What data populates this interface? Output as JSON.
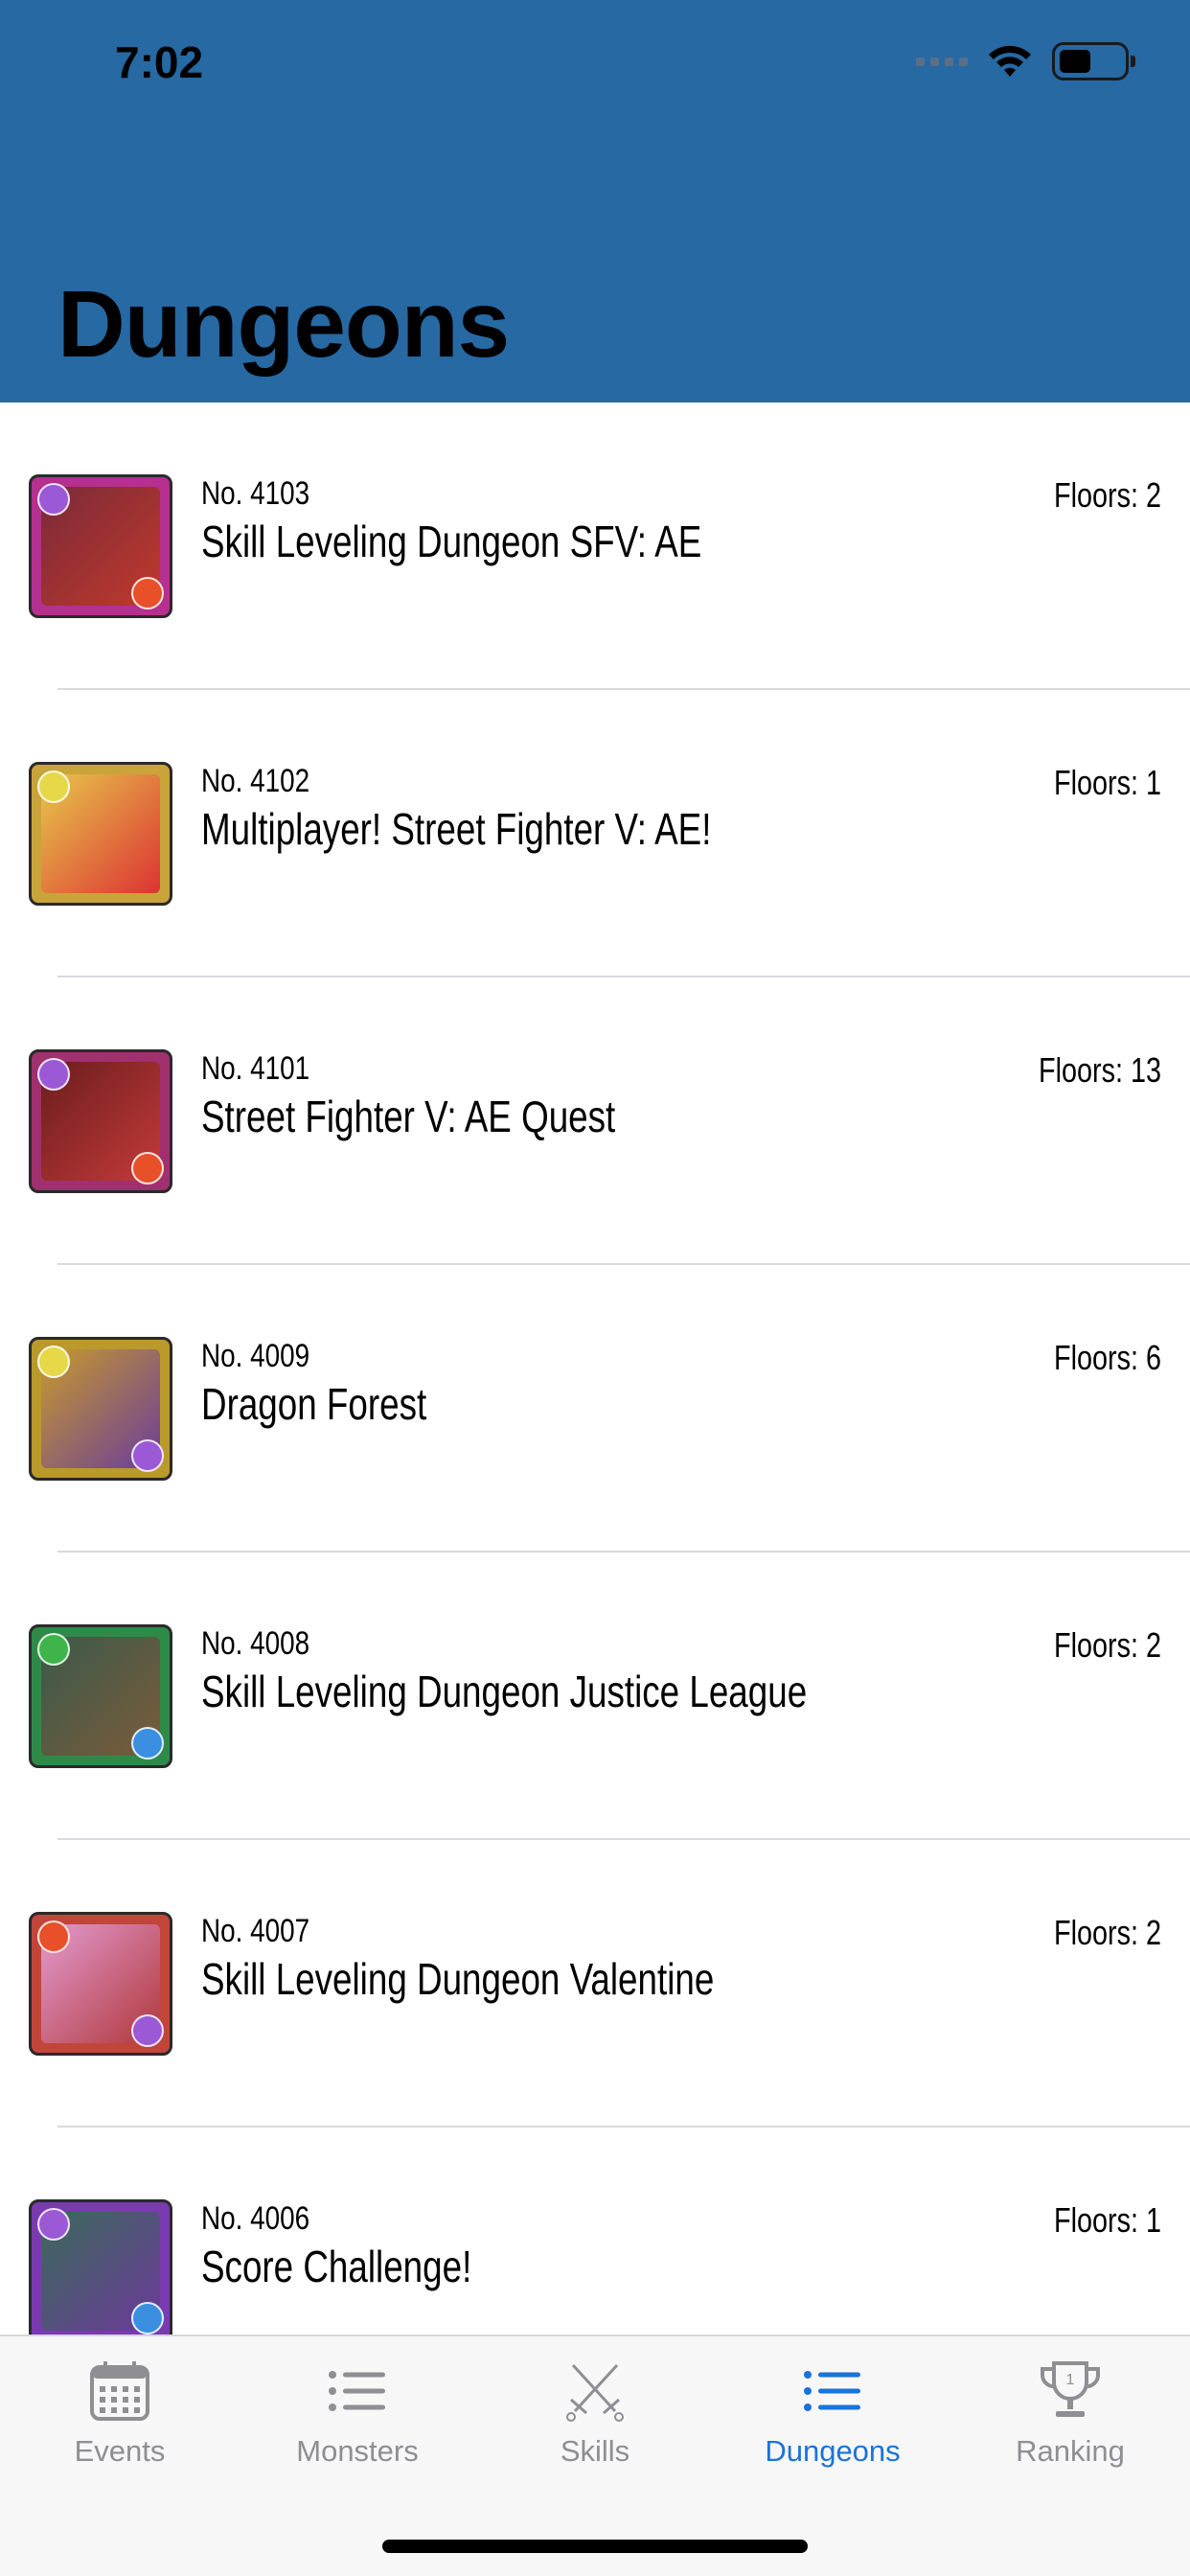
{
  "status": {
    "time": "7:02"
  },
  "header": {
    "title": "Dungeons"
  },
  "colors": {
    "header_bg": "#2669a3",
    "tab_active": "#1a73d9",
    "tab_inactive": "#8e8e93"
  },
  "dungeons": [
    {
      "number": "No. 4103",
      "name": "Skill Leveling Dungeon SFV: AE",
      "floors": "Floors: 2",
      "portrait": [
        "#7a2a3a",
        "#c0392b"
      ],
      "frame": "#b5308f",
      "orb_tl": "#9b59d6",
      "orb_br": "#e8502a"
    },
    {
      "number": "No. 4102",
      "name": "Multiplayer! Street Fighter V: AE!",
      "floors": "Floors: 1",
      "portrait": [
        "#e7c74a",
        "#d33"
      ],
      "frame": "#c9a43b",
      "orb_tl": "#e7d84a",
      "orb_br": null
    },
    {
      "number": "No. 4101",
      "name": "Street Fighter V: AE Quest",
      "floors": "Floors: 13",
      "portrait": [
        "#6b1d1d",
        "#c43a3a"
      ],
      "frame": "#a0306e",
      "orb_tl": "#9b59d6",
      "orb_br": "#e8502a"
    },
    {
      "number": "No. 4009",
      "name": "Dragon Forest",
      "floors": "Floors: 6",
      "portrait": [
        "#c89a2d",
        "#6a3d9a"
      ],
      "frame": "#b99a2b",
      "orb_tl": "#e7d84a",
      "orb_br": "#9b59d6"
    },
    {
      "number": "No. 4008",
      "name": "Skill Leveling Dungeon Justice League",
      "floors": "Floors: 2",
      "portrait": [
        "#3a5a4a",
        "#7b5b3a"
      ],
      "frame": "#2f8a4a",
      "orb_tl": "#3fb44a",
      "orb_br": "#3a8fe0"
    },
    {
      "number": "No. 4007",
      "name": "Skill Leveling Dungeon Valentine",
      "floors": "Floors: 2",
      "portrait": [
        "#e39ad0",
        "#b0383a"
      ],
      "frame": "#c2453a",
      "orb_tl": "#e8502a",
      "orb_br": "#9b59d6"
    },
    {
      "number": "No. 4006",
      "name": "Score Challenge!",
      "floors": "Floors: 1",
      "portrait": [
        "#3a6a5a",
        "#6c3a9a"
      ],
      "frame": "#7a3ab0",
      "orb_tl": "#9b59d6",
      "orb_br": "#3a8fe0"
    }
  ],
  "tabs": [
    {
      "label": "Events",
      "icon": "calendar-icon",
      "active": false
    },
    {
      "label": "Monsters",
      "icon": "list-icon",
      "active": false
    },
    {
      "label": "Skills",
      "icon": "crossed-swords-icon",
      "active": false
    },
    {
      "label": "Dungeons",
      "icon": "list-icon",
      "active": true
    },
    {
      "label": "Ranking",
      "icon": "trophy-icon",
      "active": false
    }
  ]
}
